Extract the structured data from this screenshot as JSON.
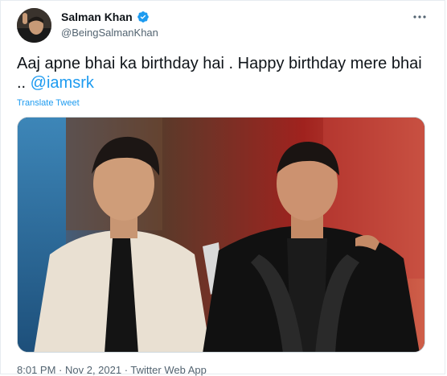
{
  "author": {
    "display_name": "Salman Khan",
    "handle": "@BeingSalmanKhan",
    "verified": true
  },
  "tweet": {
    "text": "Aaj apne bhai ka birthday hai . Happy birthday mere bhai .. ",
    "mention": "@iamsrk",
    "translate_label": "Translate Tweet"
  },
  "media": {
    "description_icon": "photo-two-men-on-stage"
  },
  "meta": {
    "time": "8:01 PM",
    "sep1": " · ",
    "date": "Nov 2, 2021",
    "sep2": " · ",
    "source": "Twitter Web App"
  },
  "colors": {
    "accent": "#1d9bf0",
    "text": "#0f1419",
    "secondary": "#536471"
  }
}
